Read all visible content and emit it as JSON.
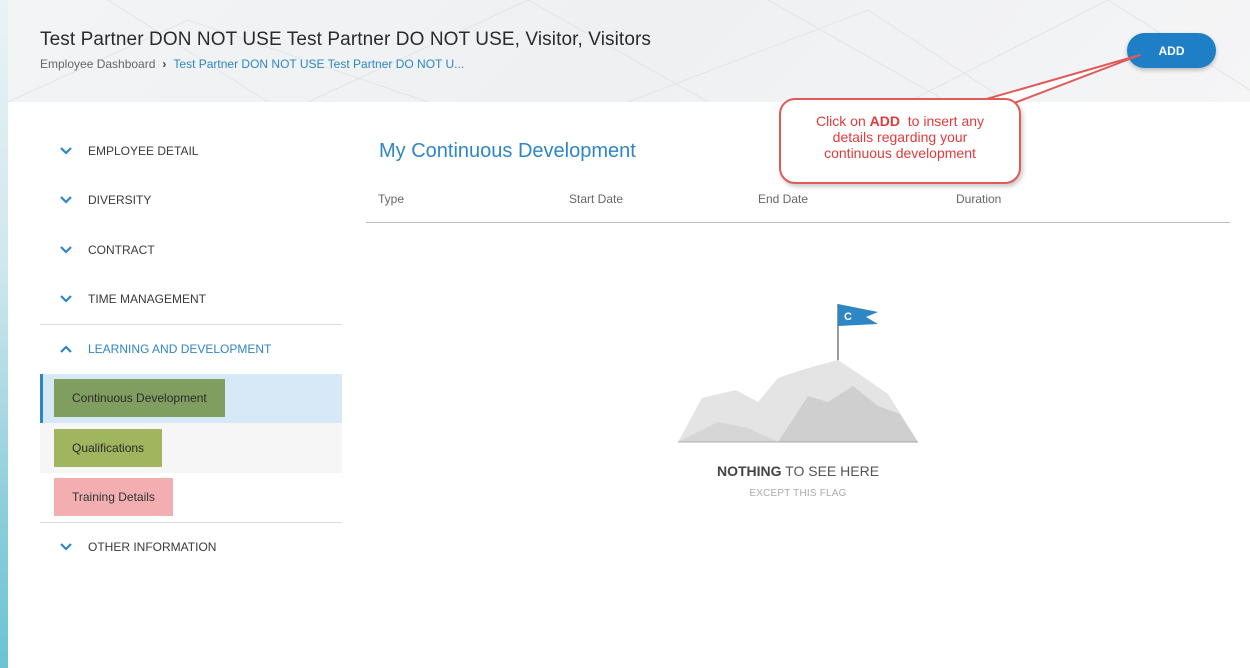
{
  "header": {
    "title": "Test Partner DON NOT USE Test Partner DO NOT USE, Visitor, Visitors",
    "breadcrumb": {
      "root": "Employee Dashboard",
      "current": "Test Partner DON NOT USE Test Partner DO NOT U..."
    },
    "add_label": "ADD"
  },
  "callout": {
    "prefix": "Click on",
    "keyword": "ADD",
    "line1_rest": "to insert any",
    "line2": "details regarding your",
    "line3": "continuous development"
  },
  "sidebar": {
    "sections": [
      {
        "label": "EMPLOYEE DETAIL"
      },
      {
        "label": "DIVERSITY"
      },
      {
        "label": "CONTRACT"
      },
      {
        "label": "TIME MANAGEMENT"
      },
      {
        "label": "LEARNING AND DEVELOPMENT"
      },
      {
        "label": "OTHER INFORMATION"
      }
    ],
    "learning_items": [
      {
        "label": "Continuous Development"
      },
      {
        "label": "Qualifications"
      },
      {
        "label": "Training Details"
      }
    ]
  },
  "main": {
    "title": "My Continuous Development",
    "columns": [
      "Type",
      "Start Date",
      "End Date",
      "Duration"
    ],
    "empty": {
      "strong": "NOTHING",
      "rest": "TO SEE HERE",
      "sub": "EXCEPT THIS FLAG",
      "flag_letter": "C"
    }
  },
  "colors": {
    "accent": "#2f86c4",
    "add_button": "#1f7fc6",
    "callout_red": "#e03b3b",
    "highlight_dark_green": "#7f9e5f",
    "highlight_green": "#9fb55e",
    "highlight_pink": "#f2aeb0"
  }
}
